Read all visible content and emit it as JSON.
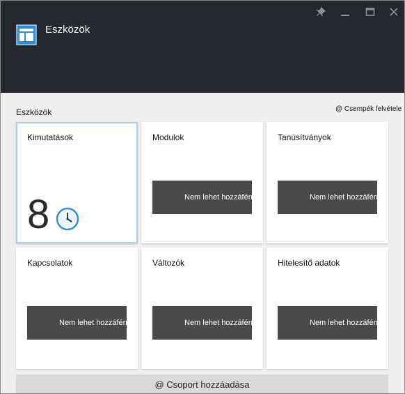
{
  "window": {
    "title": "Eszközök",
    "controls": [
      "pin-icon",
      "minimize-icon",
      "maximize-icon",
      "close-icon"
    ],
    "header_color": "#25282e"
  },
  "section": {
    "label": "Eszközök",
    "pin_link": "@ Csempék felvétele"
  },
  "tiles": [
    {
      "title": "Kimutatások",
      "value": "8",
      "icon": "clock-icon",
      "selected": true
    },
    {
      "title": "Modulok",
      "status": "Nem lehet hozzáférni"
    },
    {
      "title": "Tanúsítványok",
      "status": "Nem lehet hozzáférni"
    },
    {
      "title": "Kapcsolatok",
      "status": "Nem lehet hozzáférni"
    },
    {
      "title": "Változók",
      "status": "Nem lehet hozzáférni"
    },
    {
      "title": "Hitelesítő adatok",
      "status": "Nem lehet hozzáférni"
    }
  ],
  "add_group": {
    "label": "@ Csoport hozzáadása"
  },
  "colors": {
    "accent": "#2e8fd6",
    "selected_border": "#a9cfee",
    "unavailable_bg": "#4a4a4a"
  }
}
